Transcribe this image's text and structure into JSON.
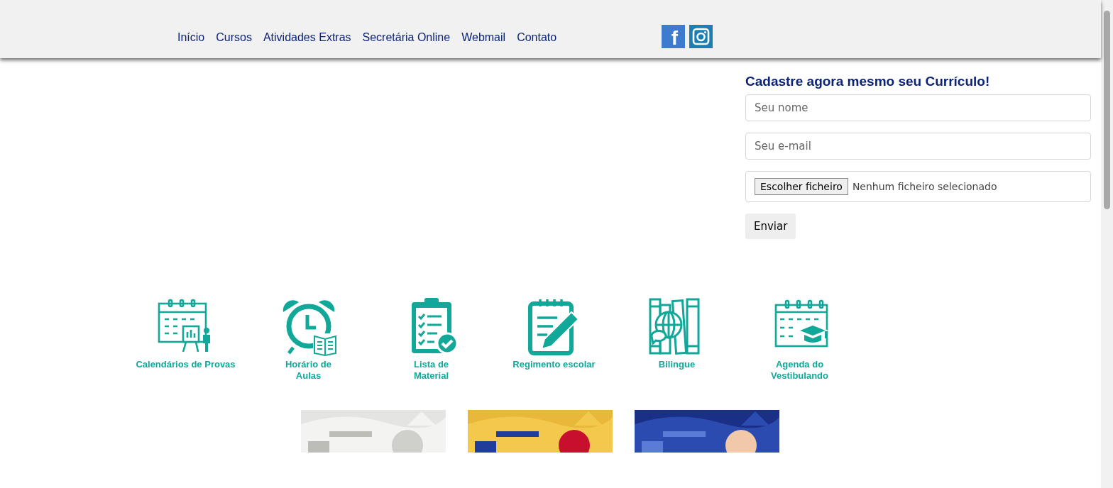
{
  "nav": {
    "links": [
      "Início",
      "Cursos",
      "Atividades Extras",
      "Secretária Online",
      "Webmail",
      "Contato"
    ],
    "social": [
      {
        "label": "f"
      }
    ]
  },
  "form": {
    "title": "Cadastre agora mesmo seu Currículo!",
    "name_placeholder": "Seu nome",
    "email_placeholder": "Seu e-mail",
    "file_button": "Escolher ficheiro",
    "file_status": "Nenhum ficheiro selecionado",
    "submit": "Enviar"
  },
  "shortcuts": [
    {
      "label": "Calendários de Provas"
    },
    {
      "label": "Horário de Aulas"
    },
    {
      "label": "Lista de Material"
    },
    {
      "label": "Regimento escolar"
    },
    {
      "label": "Bilingue"
    },
    {
      "label": "Agenda do Vestibulando"
    }
  ]
}
